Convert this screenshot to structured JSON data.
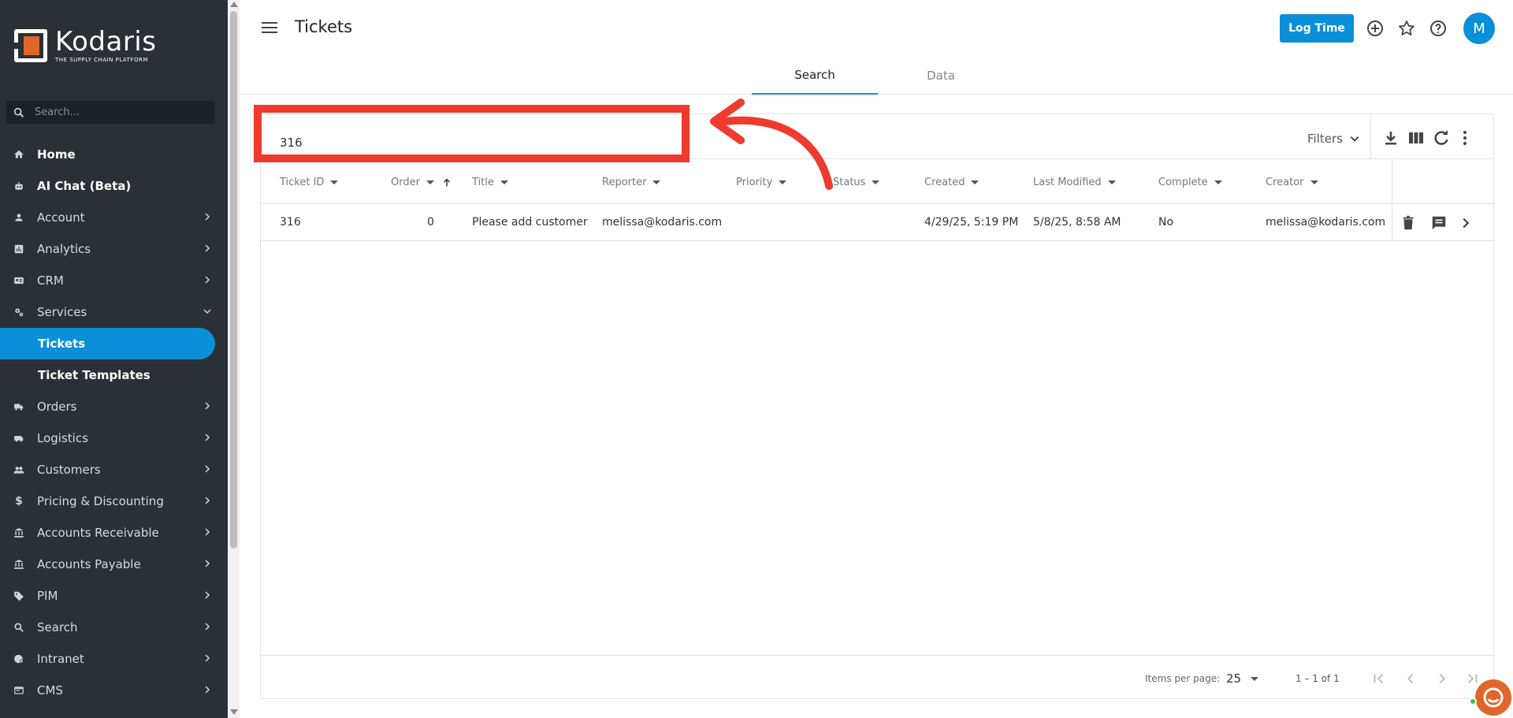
{
  "brand": {
    "name": "Kodaris",
    "tagline": "THE SUPPLY CHAIN PLATFORM",
    "accent": "#0b8fd8",
    "logo_color": "#e0662b"
  },
  "sidebar": {
    "search_placeholder": "Search...",
    "items": [
      {
        "label": "Home",
        "icon": "home-icon"
      },
      {
        "label": "AI Chat (Beta)",
        "icon": "robot-icon"
      },
      {
        "label": "Account",
        "icon": "person-icon"
      },
      {
        "label": "Analytics",
        "icon": "analytics-icon"
      },
      {
        "label": "CRM",
        "icon": "contact-card-icon"
      },
      {
        "label": "Services",
        "icon": "gears-icon"
      },
      {
        "label": "Tickets"
      },
      {
        "label": "Ticket Templates"
      },
      {
        "label": "Orders",
        "icon": "truck-icon"
      },
      {
        "label": "Logistics",
        "icon": "van-icon"
      },
      {
        "label": "Customers",
        "icon": "people-icon"
      },
      {
        "label": "Pricing & Discounting",
        "icon": "dollar-icon"
      },
      {
        "label": "Accounts Receivable",
        "icon": "bank-icon"
      },
      {
        "label": "Accounts Payable",
        "icon": "bank-icon"
      },
      {
        "label": "PIM",
        "icon": "tag-icon"
      },
      {
        "label": "Search",
        "icon": "search-icon"
      },
      {
        "label": "Intranet",
        "icon": "globe-gear-icon"
      },
      {
        "label": "CMS",
        "icon": "window-icon"
      }
    ]
  },
  "header": {
    "title": "Tickets",
    "log_time": "Log Time",
    "avatar_initial": "M"
  },
  "tabs": [
    {
      "label": "Search"
    },
    {
      "label": "Data"
    }
  ],
  "search": {
    "value": "316"
  },
  "toolbar": {
    "filters_label": "Filters"
  },
  "table": {
    "columns": [
      "Ticket ID",
      "Order",
      "Title",
      "Reporter",
      "Priority",
      "Status",
      "Created",
      "Last Modified",
      "Complete",
      "Creator"
    ],
    "rows": [
      {
        "ticket_id": "316",
        "order": "0",
        "title": "Please add customer",
        "reporter": "melissa@kodaris.com",
        "priority": "",
        "status": "",
        "created": "4/29/25, 5:19 PM",
        "last_modified": "5/8/25, 8:58 AM",
        "complete": "No",
        "creator": "melissa@kodaris.com"
      }
    ]
  },
  "pagination": {
    "items_per_page_label": "Items per page:",
    "items_per_page": "25",
    "range": "1 – 1 of 1"
  }
}
